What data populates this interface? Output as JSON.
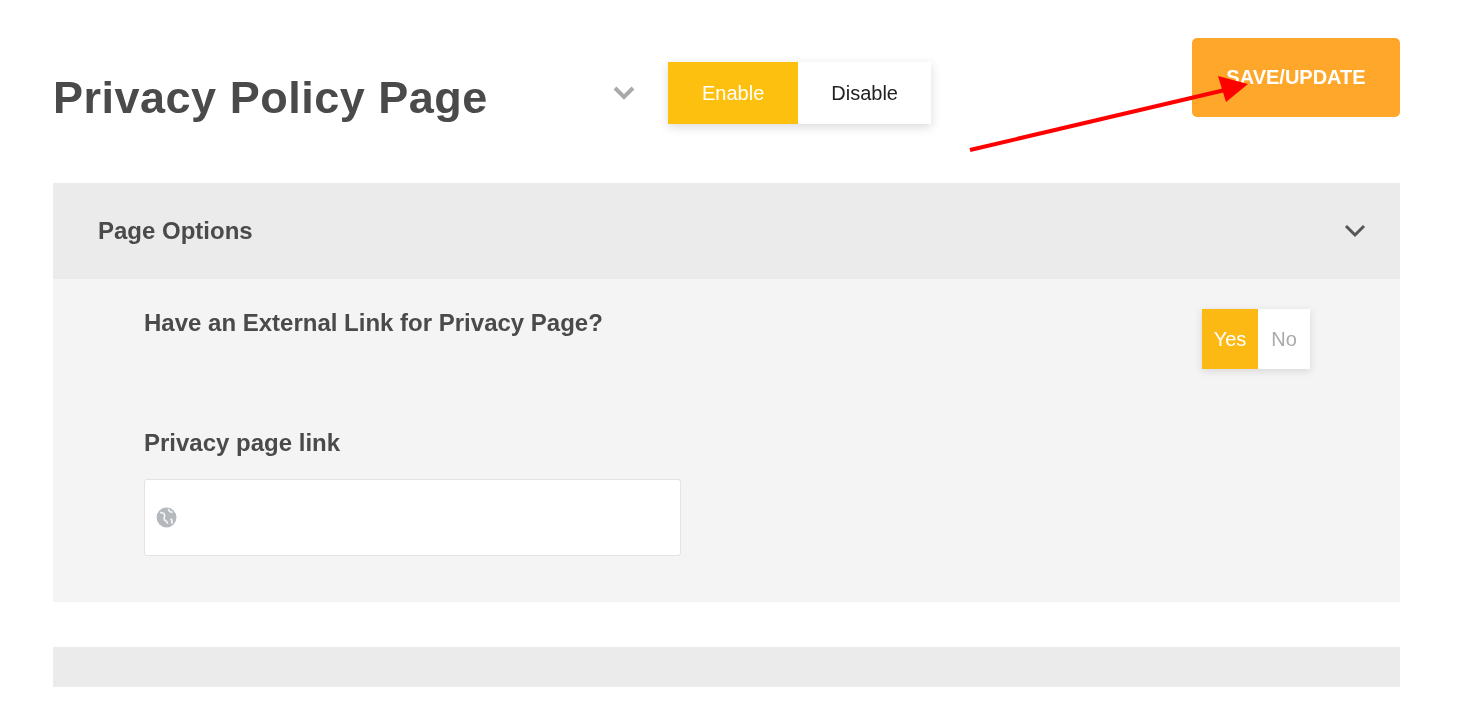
{
  "header": {
    "title": "Privacy Policy Page",
    "status_options": [
      {
        "label": "Enable",
        "selected": true
      },
      {
        "label": "Disable",
        "selected": false
      }
    ],
    "save_button": "SAVE/UPDATE"
  },
  "panel": {
    "title": "Page Options",
    "expanded": true,
    "fields": [
      {
        "kind": "switch",
        "label": "Have an External Link for Privacy Page?",
        "options": [
          {
            "label": "Yes",
            "selected": true
          },
          {
            "label": "No",
            "selected": false
          }
        ]
      },
      {
        "kind": "url",
        "label": "Privacy page link"
      }
    ]
  },
  "next_panel": {
    "expanded": false
  }
}
